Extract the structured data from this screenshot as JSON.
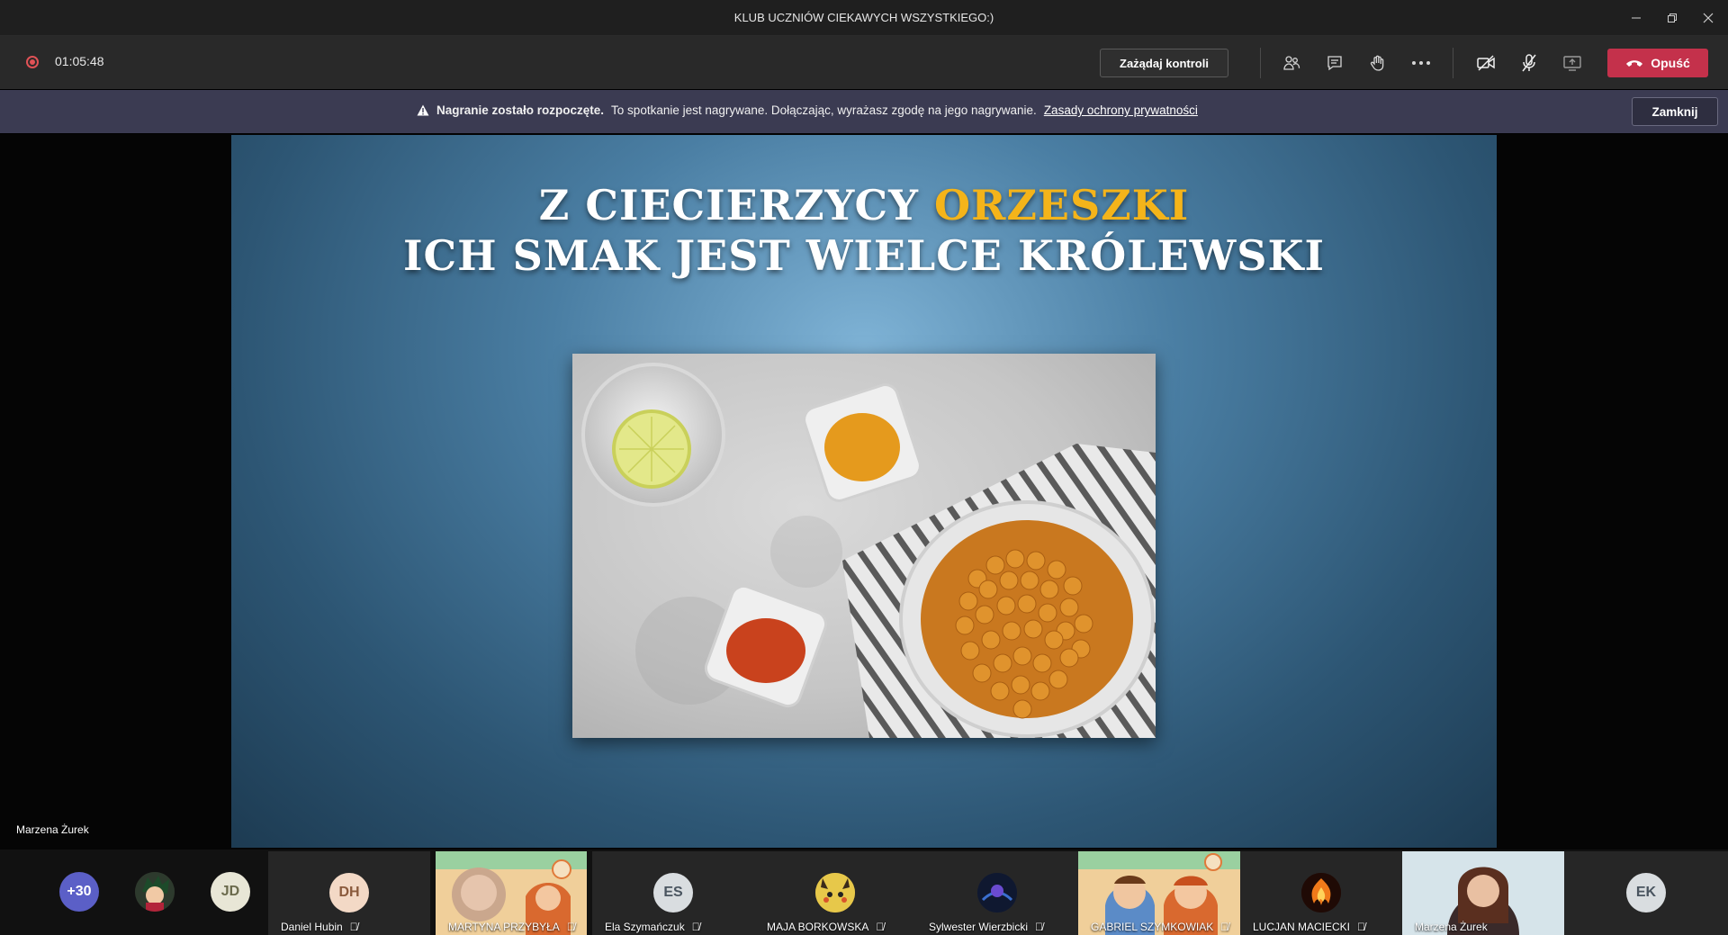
{
  "window": {
    "title": "KLUB UCZNIÓW CIEKAWYCH WSZYSTKIEGO:)"
  },
  "toolbar": {
    "timer": "01:05:48",
    "request_control_label": "Zażądaj kontroli",
    "leave_label": "Opuść"
  },
  "banner": {
    "bold_text": "Nagranie zostało rozpoczęte.",
    "text": "To spotkanie jest nagrywane. Dołączając, wyrażasz zgodę na jego nagrywanie.",
    "link_text": "Zasady ochrony prywatności",
    "close_label": "Zamknij"
  },
  "slide": {
    "title_line1_a": "Z CIECIERZYCY",
    "title_line1_b": "ORZESZKI",
    "title_line2": "ICH SMAK JEST WIELCE KRÓLEWSKI",
    "highlight_color": "#f4b41a"
  },
  "stage": {
    "speaker_name": "Marzena Żurek"
  },
  "participants": {
    "overflow_count": "+30",
    "jd_initials": "JD",
    "tiles": [
      {
        "initials": "DH",
        "name": "Daniel Hubin",
        "avatar_bg": "#f3d9c6",
        "avatar_fg": "#8a5a3c"
      },
      {
        "initials": "",
        "name": "MARTYNA PRZYBYŁA"
      },
      {
        "initials": "ES",
        "name": "Ela Szymańczuk",
        "avatar_bg": "#d9dde0",
        "avatar_fg": "#4a5560"
      },
      {
        "initials": "",
        "name": "MAJA BORKOWSKA"
      },
      {
        "initials": "",
        "name": "Sylwester Wierzbicki"
      },
      {
        "initials": "",
        "name": "GABRIEL SZYMKOWIAK"
      },
      {
        "initials": "",
        "name": "LUCJAN MACIECKI"
      },
      {
        "initials": "",
        "name": "Marzena Żurek"
      },
      {
        "initials": "EK",
        "name": "",
        "avatar_bg": "#d9dde0",
        "avatar_fg": "#4a5560"
      }
    ]
  },
  "colors": {
    "leave_red": "#c4314b",
    "recording_red": "#e05256",
    "banner_bg": "#3b3b52"
  }
}
